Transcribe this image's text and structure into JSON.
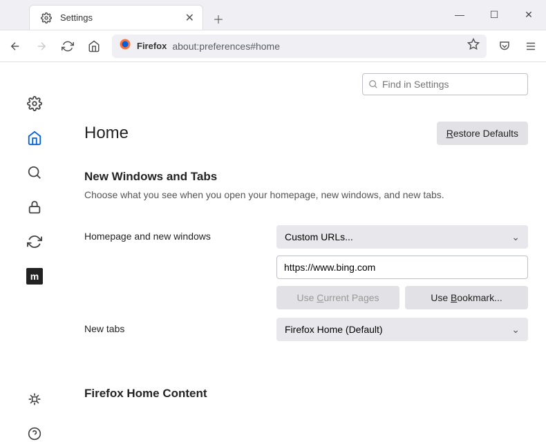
{
  "tab": {
    "title": "Settings"
  },
  "window_controls": {
    "min": "—",
    "max": "☐",
    "close": "✕"
  },
  "navbar": {
    "brand": "Firefox",
    "url": "about:preferences#home"
  },
  "search": {
    "placeholder": "Find in Settings"
  },
  "page": {
    "title": "Home",
    "restore_defaults": "Restore Defaults",
    "section_title": "New Windows and Tabs",
    "description": "Choose what you see when you open your homepage, new windows, and new tabs.",
    "homepage_label": "Homepage and new windows",
    "homepage_mode": "Custom URLs...",
    "homepage_url": "https://www.bing.com",
    "use_current": "Use Current Pages",
    "use_bookmark": "Use Bookmark...",
    "newtabs_label": "New tabs",
    "newtabs_mode": "Firefox Home (Default)",
    "content_section": "Firefox Home Content"
  }
}
